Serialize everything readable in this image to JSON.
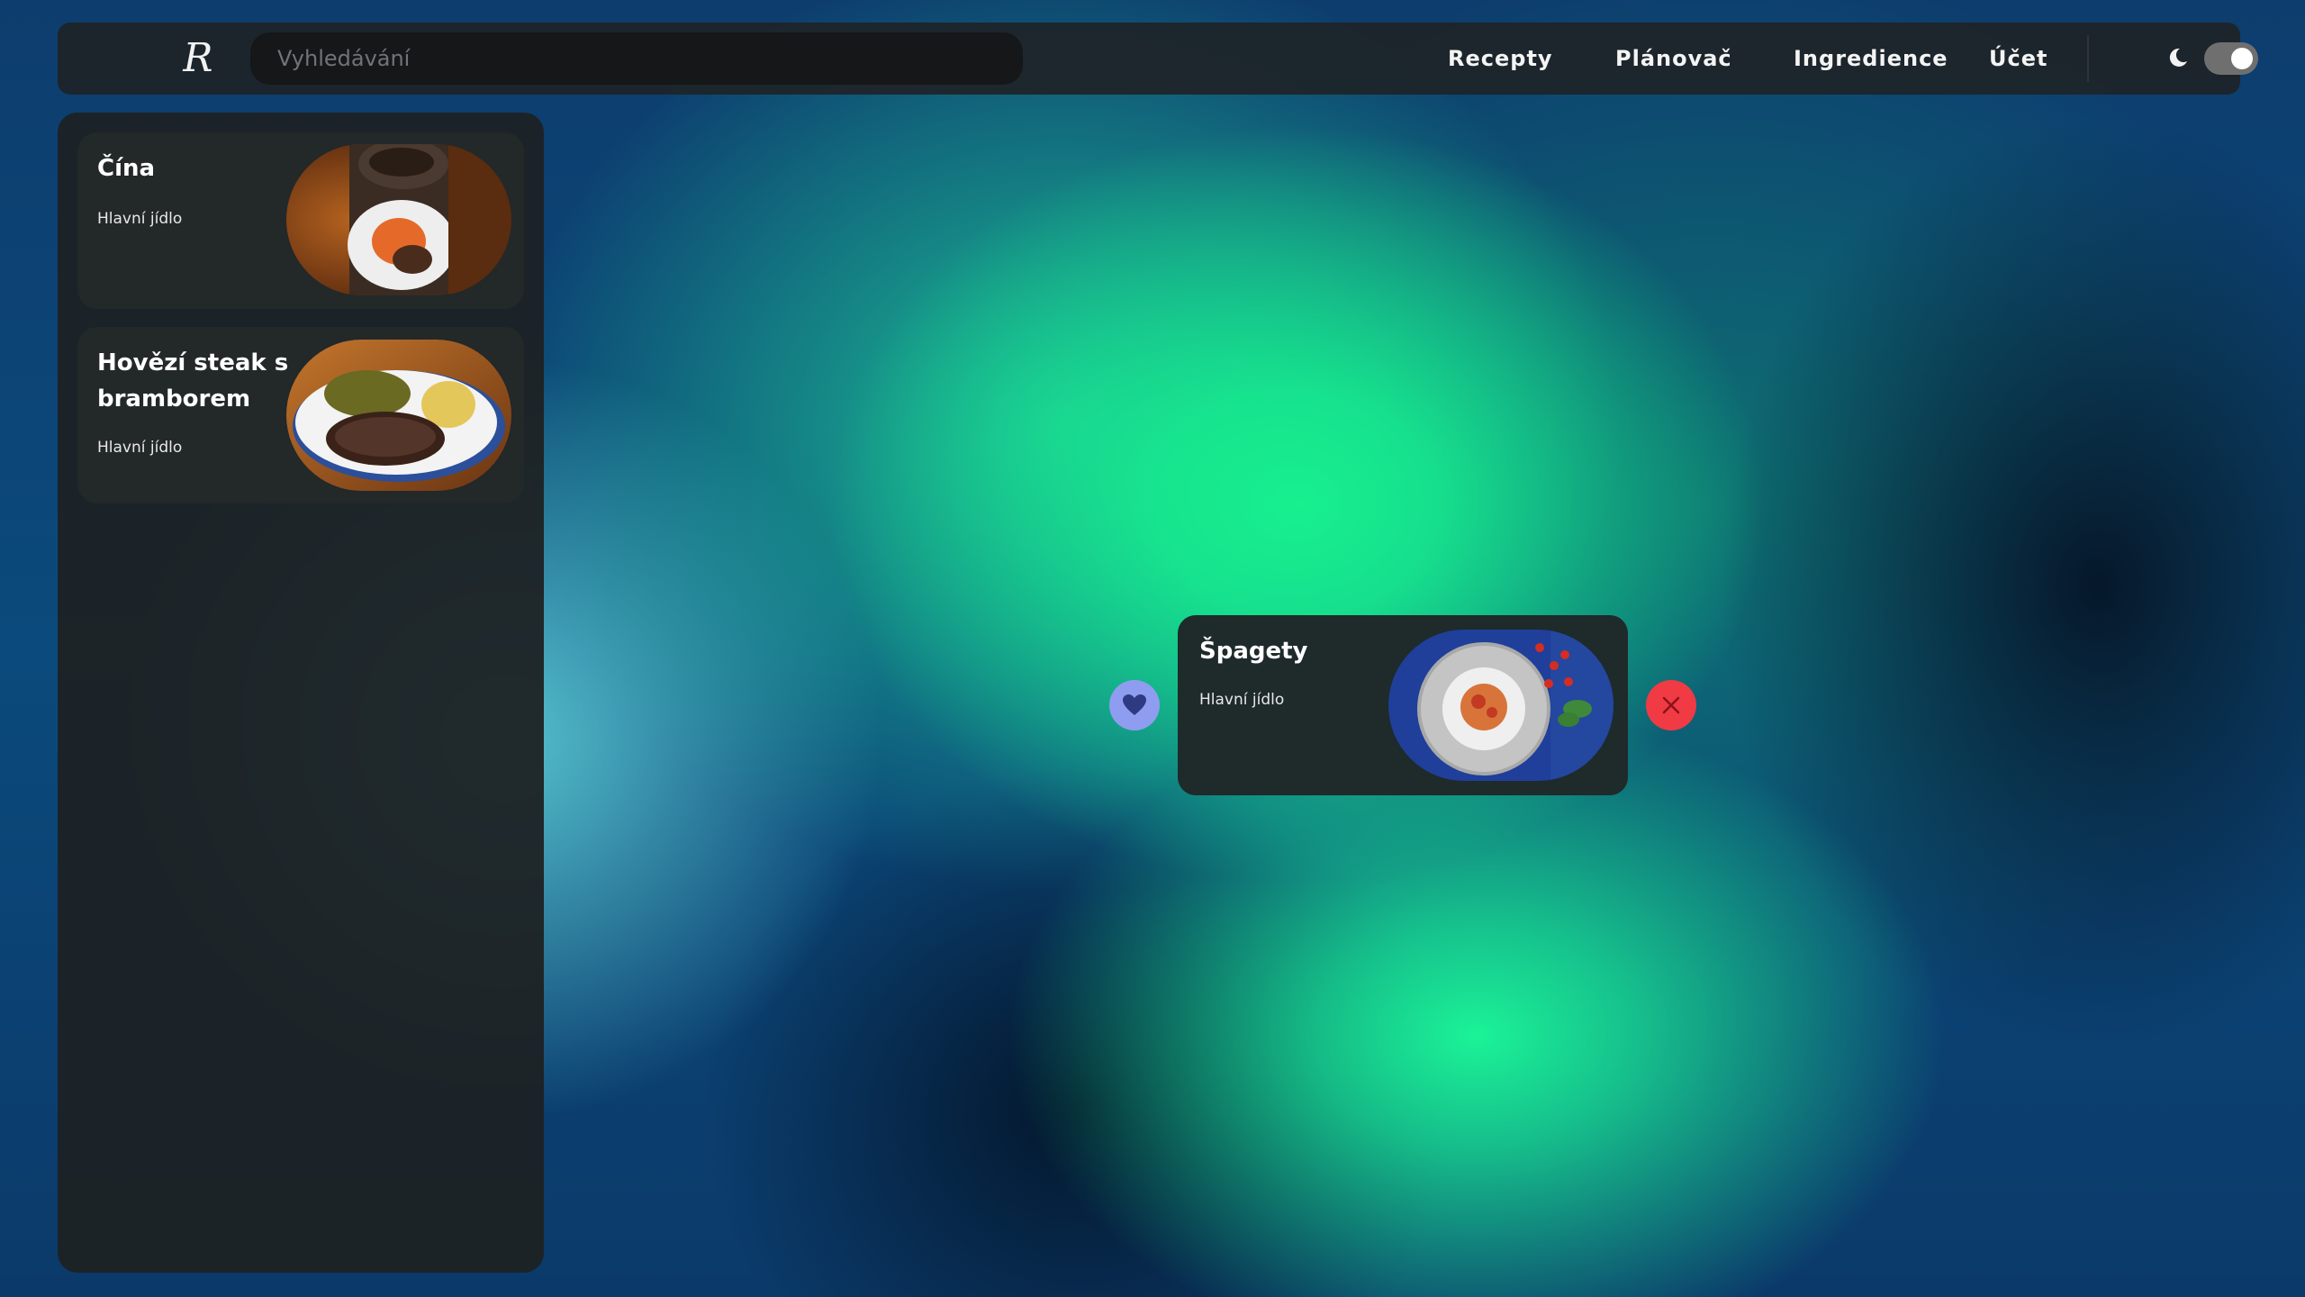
{
  "header": {
    "logo": "R",
    "search_placeholder": "Vyhledávání",
    "nav": [
      "Recepty",
      "Plánovač",
      "Ingredience",
      "Účet"
    ],
    "theme_toggle_on": true
  },
  "sidebar": {
    "recipes": [
      {
        "title": "Čína",
        "category": "Hlavní jídlo"
      },
      {
        "title": "Hovězí steak s bramborem",
        "category": "Hlavní jídlo"
      }
    ]
  },
  "dragged_card": {
    "title": "Špagety",
    "category": "Hlavní jídlo"
  },
  "colors": {
    "like_button": "#8f9df0",
    "remove_button": "#f03a44",
    "accent_green": "#17f08f"
  },
  "icons": {
    "like": "heart-icon",
    "remove": "close-icon",
    "theme": "moon-icon"
  }
}
